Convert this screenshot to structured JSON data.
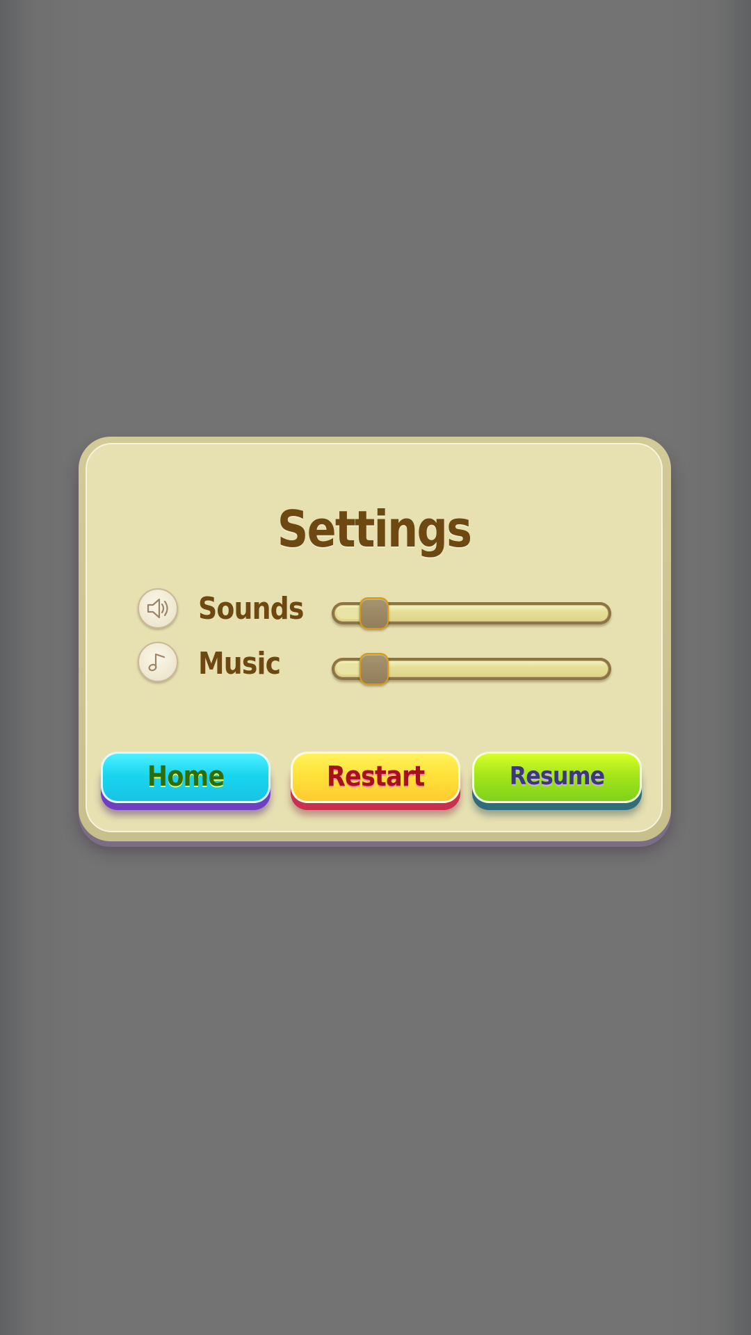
{
  "dialog": {
    "title": "Settings"
  },
  "settings": {
    "sounds": {
      "label": "Sounds",
      "icon": "speaker-icon",
      "level": 0.11
    },
    "music": {
      "label": "Music",
      "icon": "music-note-icon",
      "level": 0.11
    }
  },
  "buttons": {
    "home": {
      "label": "Home",
      "color": "#19d6ef"
    },
    "restart": {
      "label": "Restart",
      "color": "#ffe23a"
    },
    "resume": {
      "label": "Resume",
      "color": "#a6e51a"
    }
  }
}
